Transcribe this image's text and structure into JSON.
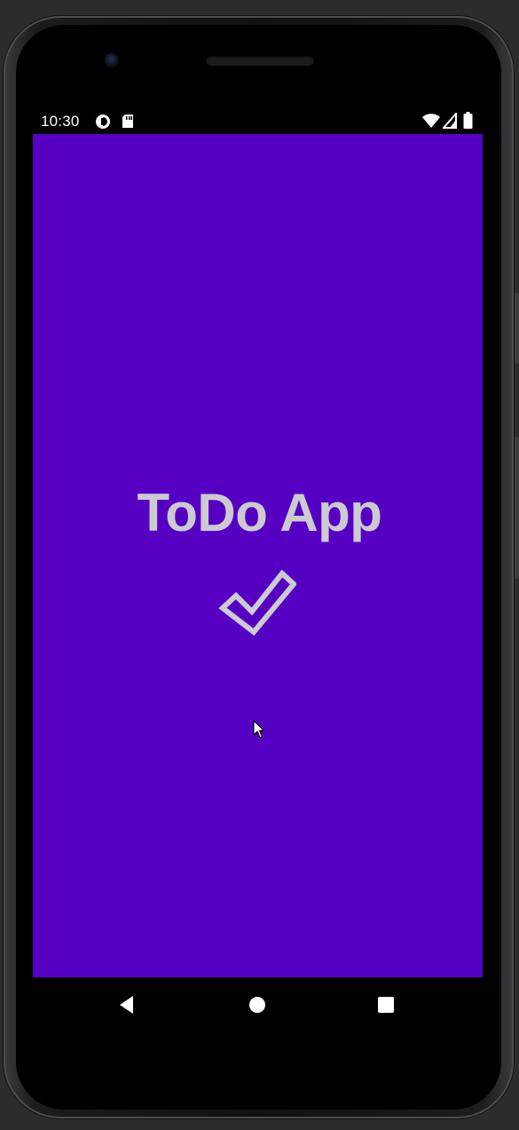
{
  "status_bar": {
    "time": "10:30",
    "left_icons": [
      "data-saver-icon",
      "sd-card-icon"
    ],
    "right_icons": [
      "wifi-icon",
      "signal-icon",
      "battery-icon"
    ]
  },
  "app": {
    "title": "ToDo App",
    "icon": "check-icon",
    "background_color": "#5600c4",
    "text_color": "#cbcbd0"
  },
  "nav_bar": {
    "buttons": [
      "back-icon",
      "home-icon",
      "recents-icon"
    ]
  }
}
